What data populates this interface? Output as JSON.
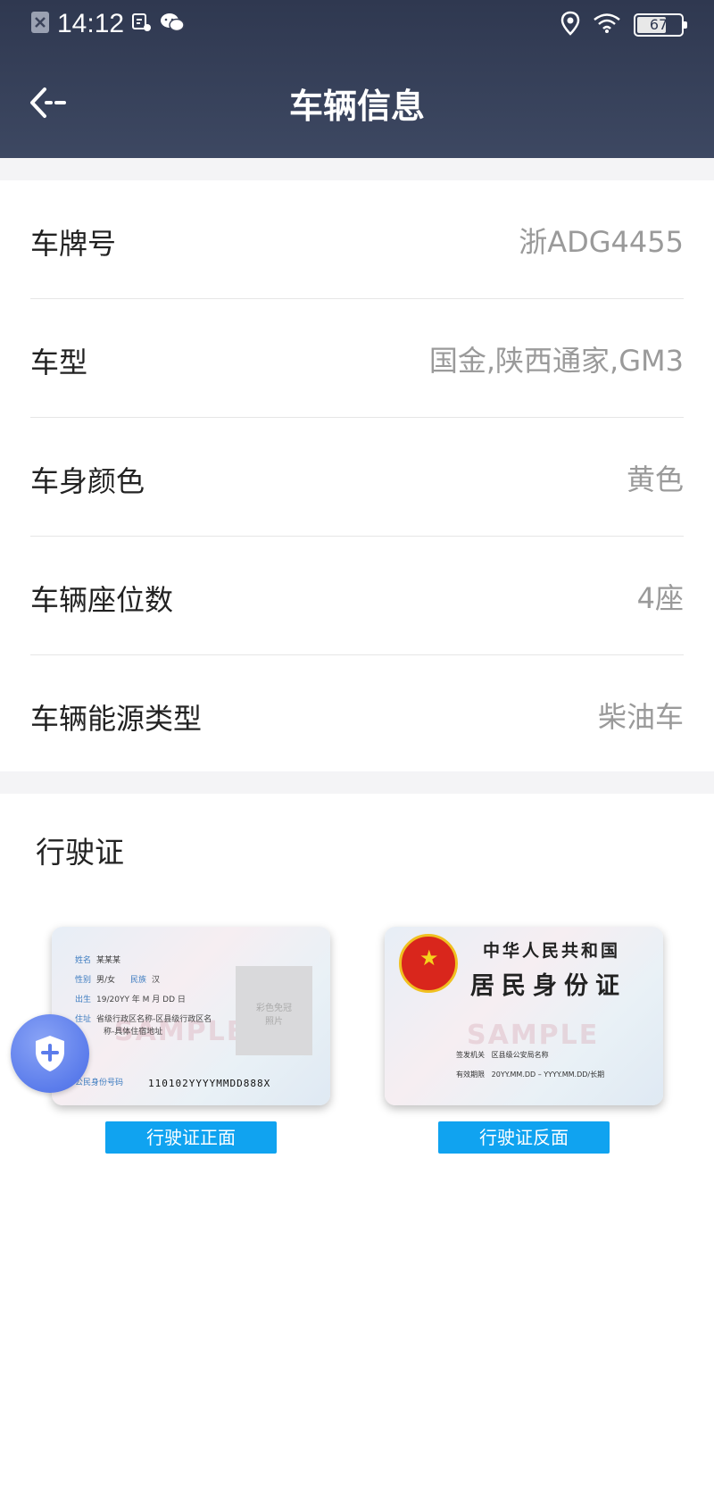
{
  "status_bar": {
    "time": "14:12",
    "battery": "67",
    "icons": [
      "notification-x-icon",
      "app-icon",
      "wechat-icon",
      "location-icon",
      "wifi-icon",
      "battery-icon"
    ]
  },
  "header": {
    "title": "车辆信息",
    "back_icon": "back-arrow-icon",
    "bg_color": "#343d56"
  },
  "vehicle_info": {
    "rows": [
      {
        "label": "车牌号",
        "value": "浙ADG4455"
      },
      {
        "label": "车型",
        "value": "国金,陕西通家,GM3"
      },
      {
        "label": "车身颜色",
        "value": "黄色"
      },
      {
        "label": "车辆座位数",
        "value": "4座"
      },
      {
        "label": "车辆能源类型",
        "value": "柴油车"
      }
    ]
  },
  "license": {
    "section_title": "行驶证",
    "front": {
      "button_label": "行驶证正面",
      "name_label": "姓名",
      "name_value": "某某某",
      "gender_label": "性别",
      "gender_value": "男/女",
      "ethnic_label": "民族",
      "ethnic_value": "汉",
      "birth_label": "出生",
      "birth_value": "19/20YY 年 M 月 DD 日",
      "address_label": "住址",
      "address_value1": "省级行政区名称-区县级行政区名",
      "address_value2": "称-具体住宿地址",
      "photo_text1": "彩色免冠",
      "photo_text2": "照片",
      "id_label": "公民身份号码",
      "id_value": "110102YYYYMMDD888X",
      "watermark": "SAMPLE"
    },
    "back": {
      "button_label": "行驶证反面",
      "country": "中华人民共和国",
      "card_name": "居民身份证",
      "authority_label": "签发机关",
      "authority_value": "区县级公安局名称",
      "validity_label": "有效期限",
      "validity_value": "20YY.MM.DD – YYYY.MM.DD/长期",
      "watermark": "SAMPLE"
    },
    "button_color": "#10a3f0"
  },
  "fab": {
    "icon": "shield-plus-icon",
    "color": "#5b7ceb"
  }
}
